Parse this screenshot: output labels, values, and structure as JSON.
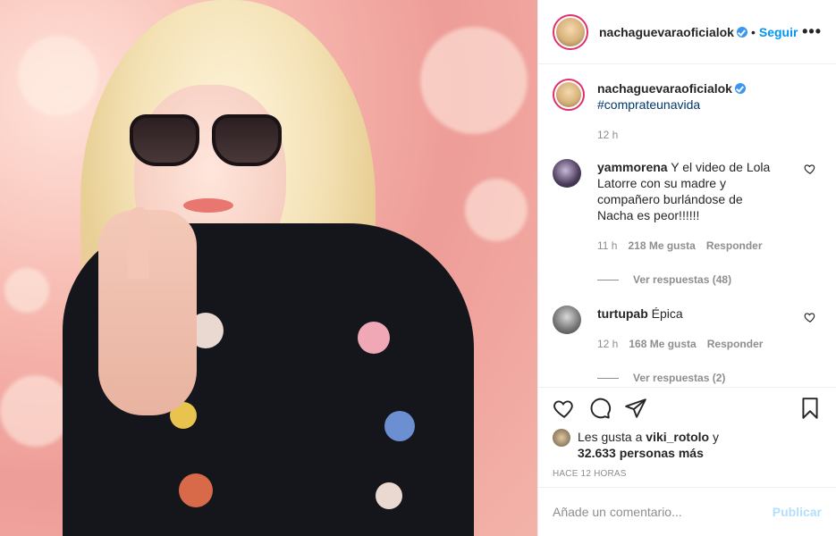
{
  "post": {
    "author": "nachaguevaraoficialok",
    "follow_label": "Seguir",
    "more_label": "•••",
    "dot": "•",
    "caption_tag": "#comprateunavida",
    "caption_time": "12 h",
    "colors": {
      "accent": "#0095f6",
      "verified": "#3897f0",
      "muted": "#8e8e8e",
      "text": "#262626"
    }
  },
  "comments": [
    {
      "user": "yammorena",
      "text": "Y el video de Lola Latorre con su madre y compañero burlándose de Nacha es peor!!!!!!",
      "time": "11 h",
      "likes": "218 Me gusta",
      "reply_label": "Responder",
      "view_replies": "Ver respuestas (48)"
    },
    {
      "user": "turtupab",
      "text": "Épica",
      "time": "12 h",
      "likes": "168 Me gusta",
      "reply_label": "Responder",
      "view_replies": "Ver respuestas (2)"
    }
  ],
  "likes_info": {
    "prefix": "Les gusta a",
    "user": "viki_rotolo",
    "conj": "y",
    "others": "32.633 personas más"
  },
  "time_ago": "HACE 12 HORAS",
  "add_comment": {
    "placeholder": "Añade un comentario...",
    "publish_label": "Publicar"
  },
  "icons": [
    "heart-icon",
    "comment-icon",
    "share-icon",
    "bookmark-icon",
    "verified-badge-icon"
  ]
}
